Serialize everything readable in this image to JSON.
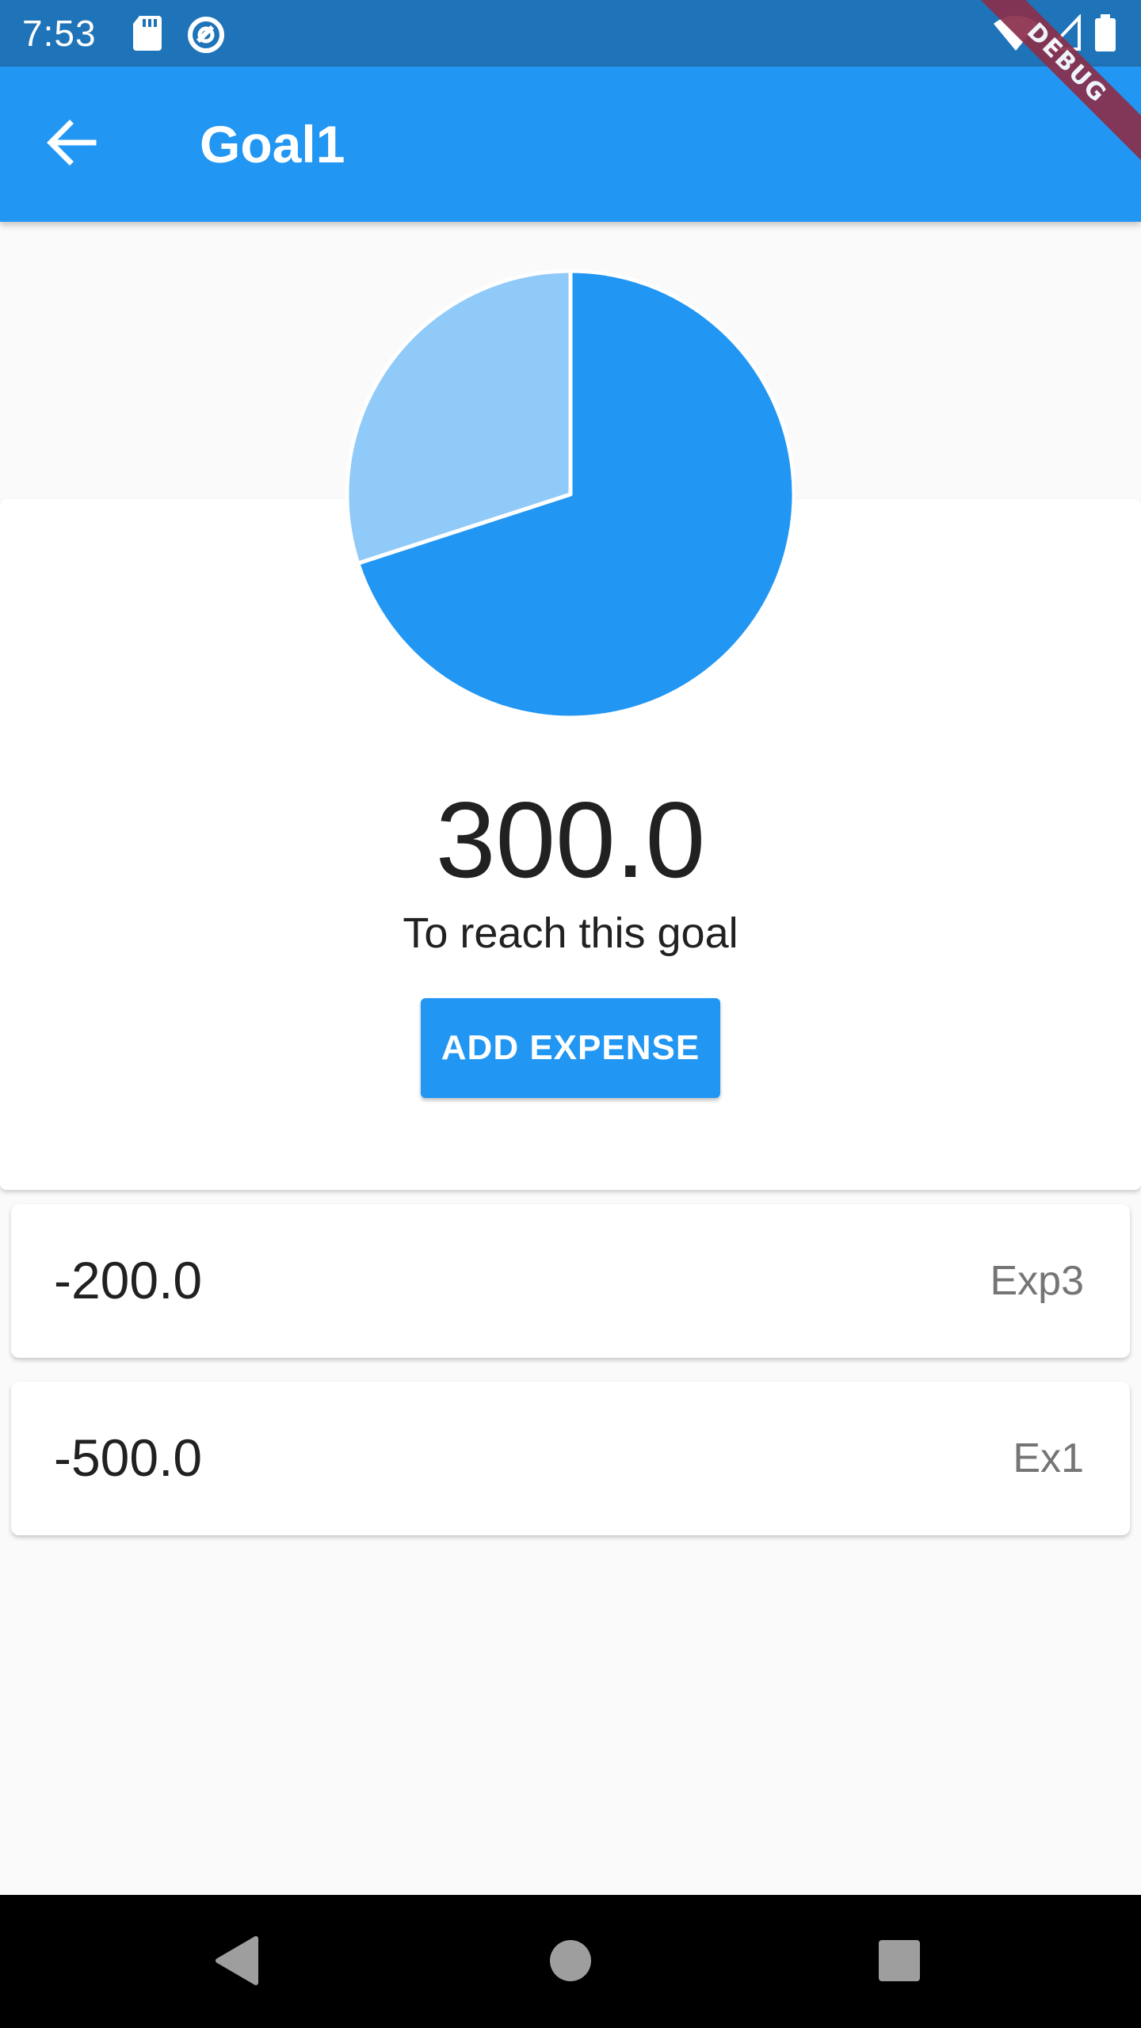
{
  "status_bar": {
    "time": "7:53",
    "left_icons": [
      "sd-card-icon",
      "sync-icon"
    ],
    "right_icons": [
      "wifi-icon",
      "cell-signal-icon",
      "battery-icon"
    ]
  },
  "debug_banner": "DEBUG",
  "app_bar": {
    "title": "Goal1",
    "back_icon": "arrow-back-icon"
  },
  "goal": {
    "remaining": "300.0",
    "caption": "To reach this goal",
    "button_label": "ADD EXPENSE"
  },
  "chart_data": {
    "type": "pie",
    "slices": [
      {
        "value": 700,
        "color": "#2196f3"
      },
      {
        "value": 300,
        "color": "#90caf9"
      }
    ]
  },
  "expenses": [
    {
      "amount": "-200.0",
      "name": "Exp3"
    },
    {
      "amount": "-500.0",
      "name": "Ex1"
    }
  ],
  "nav": [
    "back-triangle-icon",
    "home-circle-icon",
    "recents-square-icon"
  ],
  "colors": {
    "primary": "#2196f3",
    "primary_light": "#90caf9",
    "status_bar": "#1f73b8",
    "background": "#fafafa"
  }
}
